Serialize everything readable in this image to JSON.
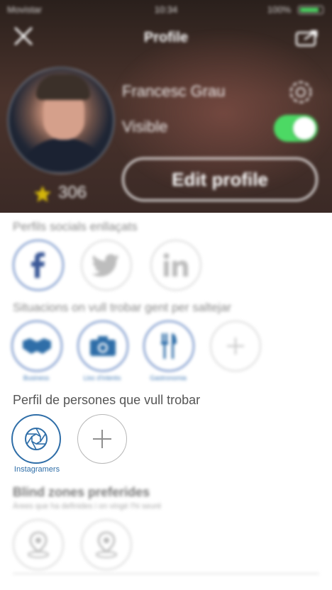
{
  "status_bar": {
    "carrier": "Movistar",
    "time": "10:34",
    "battery": "100%"
  },
  "header": {
    "title": "Profile",
    "user_name": "Francesc Grau",
    "visible_label": "Visible",
    "visible_on": true,
    "edit_profile_label": "Edit profile",
    "points": "306"
  },
  "social": {
    "title": "Perfils socials enllaçats",
    "items": [
      {
        "icon": "facebook-icon",
        "linked": true
      },
      {
        "icon": "twitter-icon",
        "linked": false
      },
      {
        "icon": "linkedin-icon",
        "linked": false
      }
    ]
  },
  "situations": {
    "title": "Situacions on vull trobar gent per saltejar",
    "items": [
      {
        "label": "Business",
        "icon": "handshake-icon"
      },
      {
        "label": "Lloc d'interès",
        "icon": "camera-icon"
      },
      {
        "label": "Gastronomia",
        "icon": "cutlery-icon"
      }
    ]
  },
  "people": {
    "title": "Perfil de persones que vull trobar",
    "items": [
      {
        "label": "Instagramers",
        "icon": "camera-shutter-icon"
      }
    ]
  },
  "zones": {
    "title": "Blind zones preferides",
    "subtitle": "Àrees que ha definides i on vingé l'hi seuré"
  },
  "colors": {
    "accent_blue": "#2f6ea8",
    "toggle_green": "#4cd964",
    "star_yellow": "#d4b60a"
  }
}
